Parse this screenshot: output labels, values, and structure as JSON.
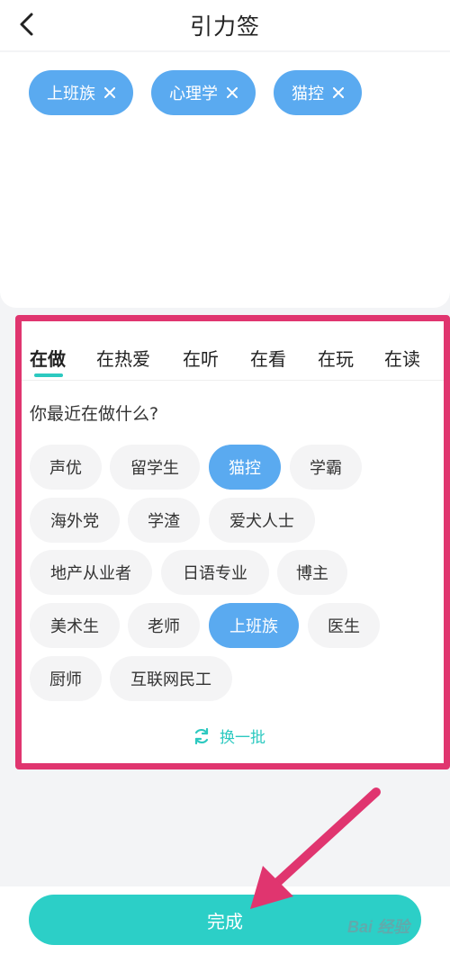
{
  "header": {
    "title": "引力签"
  },
  "selected_tags": [
    {
      "label": "上班族"
    },
    {
      "label": "心理学"
    },
    {
      "label": "猫控"
    }
  ],
  "tabs": [
    {
      "label": "在做",
      "active": true
    },
    {
      "label": "在热爱"
    },
    {
      "label": "在听"
    },
    {
      "label": "在看"
    },
    {
      "label": "在玩"
    },
    {
      "label": "在读"
    }
  ],
  "question": "你最近在做什么?",
  "chips": [
    {
      "label": "声优"
    },
    {
      "label": "留学生"
    },
    {
      "label": "猫控",
      "selected": true
    },
    {
      "label": "学霸"
    },
    {
      "label": "海外党"
    },
    {
      "label": "学渣"
    },
    {
      "label": "爱犬人士"
    },
    {
      "label": "地产从业者"
    },
    {
      "label": "日语专业"
    },
    {
      "label": "博主"
    },
    {
      "label": "美术生"
    },
    {
      "label": "老师"
    },
    {
      "label": "上班族",
      "selected": true
    },
    {
      "label": "医生"
    },
    {
      "label": "厨师"
    },
    {
      "label": "互联网民工"
    }
  ],
  "refresh_label": "换一批",
  "done_label": "完成",
  "watermark": "Bai 经验",
  "colors": {
    "accent_teal": "#2ccfc7",
    "tag_blue": "#5aaaf0",
    "annotation_pink": "#e0356f"
  }
}
